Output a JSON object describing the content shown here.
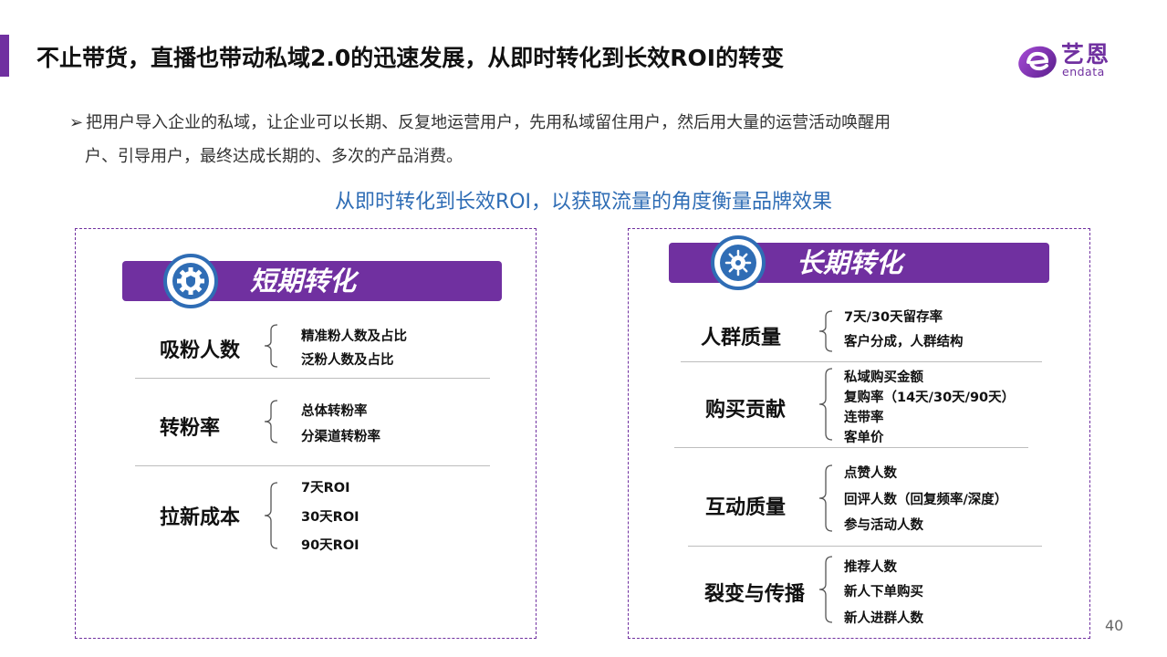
{
  "header": {
    "title": "不止带货，直播也带动私域2.0的迅速发展，从即时转化到长效ROI的转变"
  },
  "logo": {
    "cn": "艺恩",
    "en": "endata"
  },
  "intro": {
    "arrow": "➢",
    "line1": "把用户导入企业的私域，让企业可以长期、反复地运营用户，先用私域留住用户，然后用大量的运营活动唤醒用",
    "line2": "户、引导用户，最终达成长期的、多次的产品消费。"
  },
  "subtitle": "从即时转化到长效ROI，以获取流量的角度衡量品牌效果",
  "left_panel": {
    "title": "短期转化",
    "icon": "gear-shield-icon",
    "groups": [
      {
        "label": "吸粉人数",
        "items": [
          "精准粉人数及占比",
          "泛粉人数及占比"
        ]
      },
      {
        "label": "转粉率",
        "items": [
          "总体转粉率",
          "分渠道转粉率"
        ]
      },
      {
        "label": "拉新成本",
        "items": [
          "7天ROI",
          "30天ROI",
          "90天ROI"
        ]
      }
    ]
  },
  "right_panel": {
    "title": "长期转化",
    "icon": "virus-gear-icon",
    "groups": [
      {
        "label": "人群质量",
        "items": [
          "7天/30天留存率",
          "客户分成，人群结构"
        ]
      },
      {
        "label": "购买贡献",
        "items": [
          "私域购买金额",
          "复购率（14天/30天/90天）",
          "连带率",
          "客单价"
        ]
      },
      {
        "label": "互动质量",
        "items": [
          "点赞人数",
          "回评人数（回复频率/深度）",
          "参与活动人数"
        ]
      },
      {
        "label": "裂变与传播",
        "items": [
          "推荐人数",
          "新人下单购买",
          "新人进群人数"
        ]
      }
    ]
  },
  "page_number": "40",
  "colors": {
    "accent_purple": "#7030a0",
    "accent_blue": "#2f6db5"
  }
}
